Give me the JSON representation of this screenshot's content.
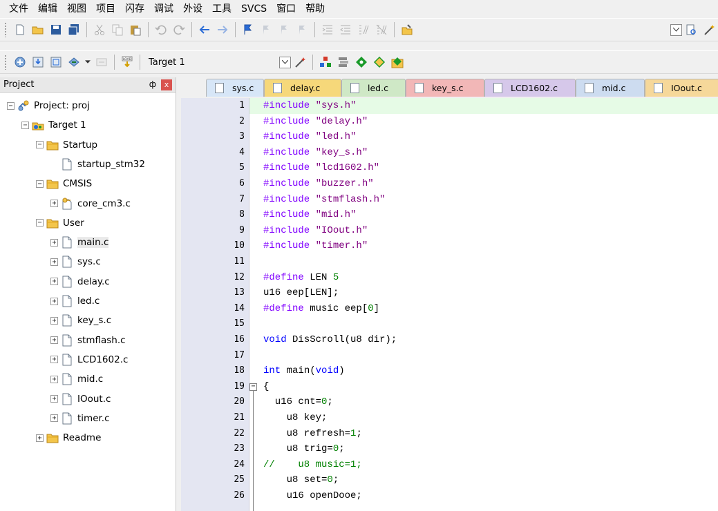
{
  "menu": [
    "文件",
    "编辑",
    "视图",
    "项目",
    "闪存",
    "调试",
    "外设",
    "工具",
    "SVCS",
    "窗口",
    "帮助"
  ],
  "build_toolbar": {
    "target": "Target 1"
  },
  "project_panel": {
    "title": "Project",
    "pin_glyph": "ф",
    "close_glyph": "x",
    "tree": [
      {
        "label": "Project: proj",
        "icon": "project-icon",
        "depth": 0,
        "expander": "−"
      },
      {
        "label": "Target 1",
        "icon": "target-icon",
        "depth": 1,
        "expander": "−"
      },
      {
        "label": "Startup",
        "icon": "folder-icon",
        "depth": 2,
        "expander": "−"
      },
      {
        "label": "startup_stm32",
        "icon": "file-icon",
        "depth": 3,
        "expander": ""
      },
      {
        "label": "CMSIS",
        "icon": "folder-icon",
        "depth": 2,
        "expander": "−"
      },
      {
        "label": "core_cm3.c",
        "icon": "key-file-icon",
        "depth": 3,
        "expander": "+"
      },
      {
        "label": "User",
        "icon": "folder-icon",
        "depth": 2,
        "expander": "−"
      },
      {
        "label": "main.c",
        "icon": "file-icon",
        "depth": 3,
        "expander": "+",
        "selected": true
      },
      {
        "label": "sys.c",
        "icon": "file-icon",
        "depth": 3,
        "expander": "+"
      },
      {
        "label": "delay.c",
        "icon": "file-icon",
        "depth": 3,
        "expander": "+"
      },
      {
        "label": "led.c",
        "icon": "file-icon",
        "depth": 3,
        "expander": "+"
      },
      {
        "label": "key_s.c",
        "icon": "file-icon",
        "depth": 3,
        "expander": "+"
      },
      {
        "label": "stmflash.c",
        "icon": "file-icon",
        "depth": 3,
        "expander": "+"
      },
      {
        "label": "LCD1602.c",
        "icon": "file-icon",
        "depth": 3,
        "expander": "+"
      },
      {
        "label": "mid.c",
        "icon": "file-icon",
        "depth": 3,
        "expander": "+"
      },
      {
        "label": "IOout.c",
        "icon": "file-icon",
        "depth": 3,
        "expander": "+"
      },
      {
        "label": "timer.c",
        "icon": "file-icon",
        "depth": 3,
        "expander": "+"
      },
      {
        "label": "Readme",
        "icon": "folder-icon",
        "depth": 2,
        "expander": "+"
      }
    ]
  },
  "tabs": [
    {
      "label": "sys.c",
      "color": "#d7e6f7"
    },
    {
      "label": "delay.c",
      "color": "#f6d87a"
    },
    {
      "label": "led.c",
      "color": "#cfe8c6"
    },
    {
      "label": "key_s.c",
      "color": "#f2b7b7"
    },
    {
      "label": "LCD1602.c",
      "color": "#d6c8ea"
    },
    {
      "label": "mid.c",
      "color": "#cddcf0"
    },
    {
      "label": "IOout.c",
      "color": "#f6d89a"
    }
  ],
  "code_lines": [
    "#include \"sys.h\"",
    "#include \"delay.h\"",
    "#include \"led.h\"",
    "#include \"key_s.h\"",
    "#include \"lcd1602.h\"",
    "#include \"buzzer.h\"",
    "#include \"stmflash.h\"",
    "#include \"mid.h\"",
    "#include \"IOout.h\"",
    "#include \"timer.h\"",
    "",
    "#define LEN 5",
    "u16 eep[LEN];",
    "#define music eep[0]",
    "",
    "void DisScroll(u8 dir);",
    "",
    "int main(void)",
    "{",
    "  u16 cnt=0;",
    "    u8 key;",
    "    u8 refresh=1;",
    "    u8 trig=0;",
    "//    u8 music=1;",
    "    u8 set=0;",
    "    u16 openDooe;"
  ],
  "colors": {
    "keyword": "#0000ff",
    "preprocessor": "#8000ff",
    "number": "#008000",
    "comment": "#008000",
    "string": "#800080",
    "current_line": "#e6fbe6",
    "gutter": "#e4e6f2"
  }
}
